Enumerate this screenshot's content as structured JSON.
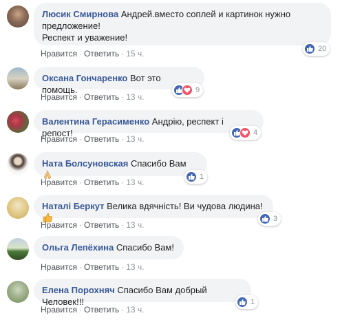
{
  "labels": {
    "like": "Нравится",
    "reply": "Ответить",
    "sep": "·"
  },
  "colors": {
    "author": "#385898",
    "bubble": "#f2f3f5",
    "like": "#4267b2",
    "love": "#f25268"
  },
  "comments": [
    {
      "author": "Люсик Смирнова",
      "text": "Андрей.вместо соплей и картинок нужно предложение!",
      "text2": "Респект и уважение!",
      "time": "15 ч.",
      "reactions": [
        "like-icon"
      ],
      "count": "20"
    },
    {
      "author": "Оксана Гончаренко",
      "text": "Вот это помощь.",
      "time": "13 ч.",
      "reactions": [
        "like-icon",
        "love-icon"
      ],
      "count": "9"
    },
    {
      "author": "Валентина Герасименко",
      "text": "Андрію, респект і репост!",
      "time": "13 ч.",
      "reactions": [
        "like-icon",
        "love-icon"
      ],
      "count": "4"
    },
    {
      "author": "Ната Болсуновская",
      "text": "Спасибо Вам",
      "emoji": "praying-hands-icon",
      "time": "13 ч.",
      "reactions": [
        "like-icon"
      ],
      "count": "1"
    },
    {
      "author": "Наталі Беркут",
      "text": "Велика вдячність! Ви чудова людина!",
      "emoji": "thumbs-up-icon",
      "time": "13 ч.",
      "reactions": [
        "like-icon"
      ],
      "count": "3"
    },
    {
      "author": "Ольга Лепёхина",
      "text": "Спасибо Вам!",
      "time": "13 ч.",
      "reactions": [],
      "count": ""
    },
    {
      "author": "Елена Порохняч",
      "text": "Спасибо Вам добрый Человек!!!",
      "time": "13 ч.",
      "reactions": [
        "like-icon"
      ],
      "count": "1"
    }
  ]
}
